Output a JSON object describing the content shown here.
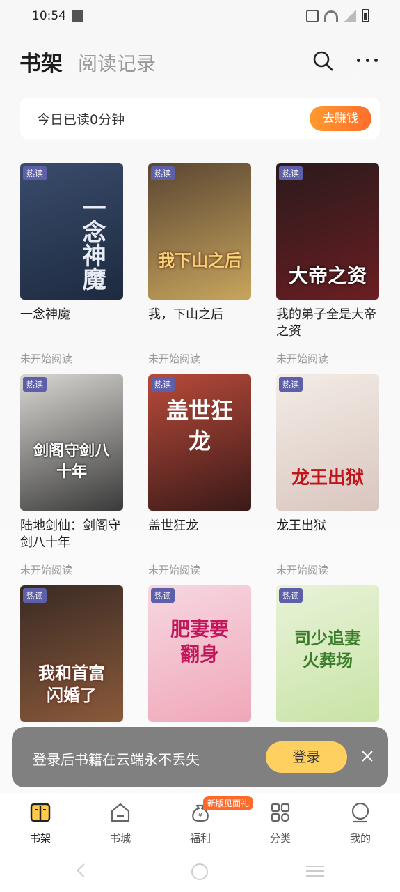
{
  "status_bar": {
    "time": "10:54"
  },
  "header": {
    "tab_shelf": "书架",
    "tab_history": "阅读记录"
  },
  "read_banner": {
    "text": "今日已读0分钟",
    "button": "去赚钱"
  },
  "books": [
    {
      "badge": "热读",
      "title": "一念神魔",
      "status": "未开始阅读",
      "cover_text": "一念神魔",
      "colors": [
        "#3a4c6b",
        "#1d2a40"
      ]
    },
    {
      "badge": "热读",
      "title": "我，下山之后",
      "status": "未开始阅读",
      "cover_text": "我下山之后",
      "colors": [
        "#5a4632",
        "#c8a55d"
      ]
    },
    {
      "badge": "热读",
      "title": "我的弟子全是大帝之资",
      "status": "未开始阅读",
      "cover_text": "大帝之资",
      "colors": [
        "#2a1a1c",
        "#6a1e22"
      ]
    },
    {
      "badge": "热读",
      "title": "陆地剑仙：剑阁守剑八十年",
      "status": "未开始阅读",
      "cover_text": "剑阁守剑八十年",
      "colors": [
        "#d9d7d2",
        "#3a3a3a"
      ]
    },
    {
      "badge": "热读",
      "title": "盖世狂龙",
      "status": "未开始阅读",
      "cover_text": "盖世狂龙",
      "colors": [
        "#b84a3a",
        "#3a1a18"
      ]
    },
    {
      "badge": "热读",
      "title": "龙王出狱",
      "status": "未开始阅读",
      "cover_text": "龙王出狱",
      "colors": [
        "#f3ece6",
        "#d9c6bf"
      ]
    },
    {
      "badge": "热读",
      "title": "",
      "status": "",
      "cover_text": "我和首富闪婚了",
      "colors": [
        "#3a2a24",
        "#8a5a3a"
      ]
    },
    {
      "badge": "热读",
      "title": "",
      "status": "",
      "cover_text": "肥妻要翻身",
      "colors": [
        "#f6d7e0",
        "#f0a7b9"
      ]
    },
    {
      "badge": "热读",
      "title": "",
      "status": "",
      "cover_text": "司少追妻火葬场",
      "colors": [
        "#e8f3d8",
        "#c9e3a6"
      ]
    }
  ],
  "login_toast": {
    "text": "登录后书籍在云端永不丢失",
    "button": "登录"
  },
  "tab_bar": {
    "items": [
      {
        "label": "书架"
      },
      {
        "label": "书城"
      },
      {
        "label": "福利"
      },
      {
        "label": "分类"
      },
      {
        "label": "我的"
      }
    ],
    "welfare_badge": "新版见面礼"
  },
  "colors": {
    "accent_orange": "#ff7a2c",
    "login_yellow": "#ffcf5a",
    "badge_purple": "#5d5fa8"
  }
}
